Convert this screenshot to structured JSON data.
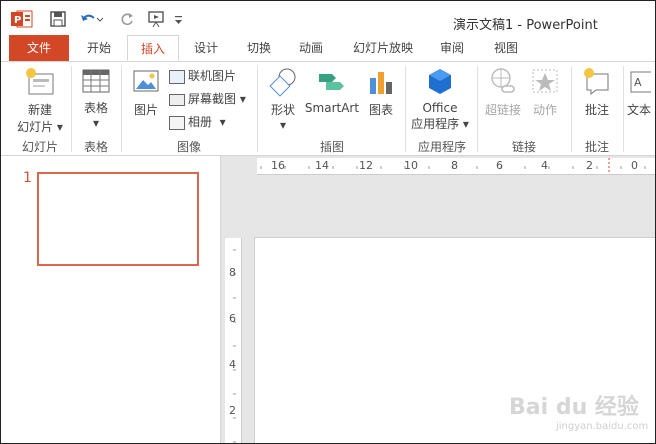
{
  "titlebar": {
    "title": "演示文稿1 - PowerPoint",
    "app_icon": "powerpoint-icon",
    "quick_access": [
      "save-icon",
      "undo-icon",
      "redo-icon",
      "slideshow-icon",
      "customize-icon"
    ]
  },
  "tabs": {
    "file": "文件",
    "home": "开始",
    "insert": "插入",
    "design": "设计",
    "transitions": "切换",
    "animations": "动画",
    "slideshow": "幻灯片放映",
    "review": "审阅",
    "view": "视图"
  },
  "ribbon": {
    "new_slide": "新建\n幻灯片",
    "new_slide_line1": "新建",
    "new_slide_line2": "幻灯片",
    "group_slides": "幻灯片",
    "table": "表格",
    "group_tables": "表格",
    "pictures": "图片",
    "online_pictures": "联机图片",
    "screenshot": "屏幕截图",
    "album": "相册",
    "group_images": "图像",
    "shapes": "形状",
    "smartart": "SmartArt",
    "chart": "图表",
    "group_illustrations": "插图",
    "office_apps_line1": "Office",
    "office_apps_line2": "应用程序",
    "group_apps": "应用程序",
    "hyperlink": "超链接",
    "action": "动作",
    "group_links": "链接",
    "comment": "批注",
    "group_comments": "批注",
    "textbox_partial": "文本"
  },
  "slides_panel": {
    "slide_number": "1"
  },
  "rulers": {
    "horizontal": [
      "16",
      "14",
      "12",
      "10",
      "8",
      "6",
      "4",
      "2",
      "0"
    ],
    "vertical": [
      "8",
      "6",
      "4",
      "2"
    ]
  },
  "watermark": {
    "text": "Bai du 经验",
    "url": "jingyan.baidu.com"
  },
  "colors": {
    "accent": "#d24726",
    "thumb_border": "#d9694c"
  }
}
